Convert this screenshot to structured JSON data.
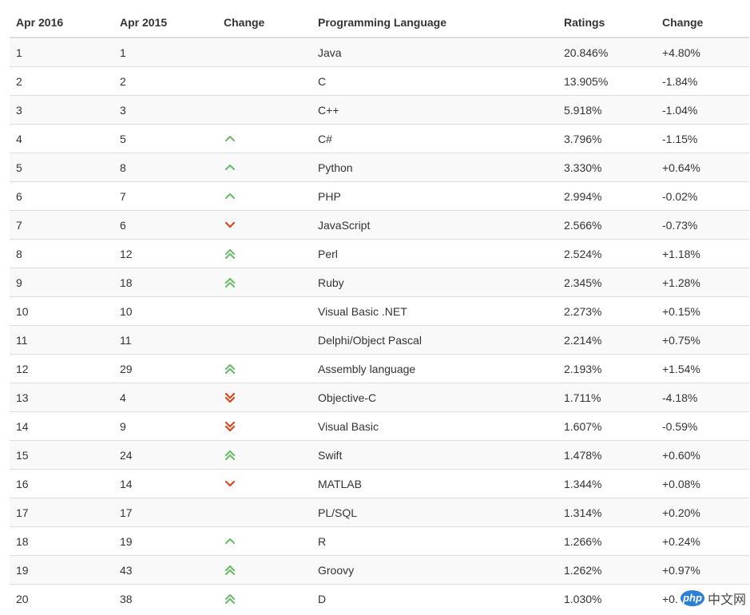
{
  "table": {
    "headers": [
      "Apr 2016",
      "Apr 2015",
      "Change",
      "Programming Language",
      "Ratings",
      "Change"
    ],
    "rows": [
      {
        "rank_2016": "1",
        "rank_2015": "1",
        "trend": "none",
        "language": "Java",
        "rating": "20.846%",
        "change": "+4.80%"
      },
      {
        "rank_2016": "2",
        "rank_2015": "2",
        "trend": "none",
        "language": "C",
        "rating": "13.905%",
        "change": "-1.84%"
      },
      {
        "rank_2016": "3",
        "rank_2015": "3",
        "trend": "none",
        "language": "C++",
        "rating": "5.918%",
        "change": "-1.04%"
      },
      {
        "rank_2016": "4",
        "rank_2015": "5",
        "trend": "up",
        "language": "C#",
        "rating": "3.796%",
        "change": "-1.15%"
      },
      {
        "rank_2016": "5",
        "rank_2015": "8",
        "trend": "up",
        "language": "Python",
        "rating": "3.330%",
        "change": "+0.64%"
      },
      {
        "rank_2016": "6",
        "rank_2015": "7",
        "trend": "up",
        "language": "PHP",
        "rating": "2.994%",
        "change": "-0.02%"
      },
      {
        "rank_2016": "7",
        "rank_2015": "6",
        "trend": "down",
        "language": "JavaScript",
        "rating": "2.566%",
        "change": "-0.73%"
      },
      {
        "rank_2016": "8",
        "rank_2015": "12",
        "trend": "double-up",
        "language": "Perl",
        "rating": "2.524%",
        "change": "+1.18%"
      },
      {
        "rank_2016": "9",
        "rank_2015": "18",
        "trend": "double-up",
        "language": "Ruby",
        "rating": "2.345%",
        "change": "+1.28%"
      },
      {
        "rank_2016": "10",
        "rank_2015": "10",
        "trend": "none",
        "language": "Visual Basic .NET",
        "rating": "2.273%",
        "change": "+0.15%"
      },
      {
        "rank_2016": "11",
        "rank_2015": "11",
        "trend": "none",
        "language": "Delphi/Object Pascal",
        "rating": "2.214%",
        "change": "+0.75%"
      },
      {
        "rank_2016": "12",
        "rank_2015": "29",
        "trend": "double-up",
        "language": "Assembly language",
        "rating": "2.193%",
        "change": "+1.54%"
      },
      {
        "rank_2016": "13",
        "rank_2015": "4",
        "trend": "double-down",
        "language": "Objective-C",
        "rating": "1.711%",
        "change": "-4.18%"
      },
      {
        "rank_2016": "14",
        "rank_2015": "9",
        "trend": "double-down",
        "language": "Visual Basic",
        "rating": "1.607%",
        "change": "-0.59%"
      },
      {
        "rank_2016": "15",
        "rank_2015": "24",
        "trend": "double-up",
        "language": "Swift",
        "rating": "1.478%",
        "change": "+0.60%"
      },
      {
        "rank_2016": "16",
        "rank_2015": "14",
        "trend": "down",
        "language": "MATLAB",
        "rating": "1.344%",
        "change": "+0.08%"
      },
      {
        "rank_2016": "17",
        "rank_2015": "17",
        "trend": "none",
        "language": "PL/SQL",
        "rating": "1.314%",
        "change": "+0.20%"
      },
      {
        "rank_2016": "18",
        "rank_2015": "19",
        "trend": "up",
        "language": "R",
        "rating": "1.266%",
        "change": "+0.24%"
      },
      {
        "rank_2016": "19",
        "rank_2015": "43",
        "trend": "double-up",
        "language": "Groovy",
        "rating": "1.262%",
        "change": "+0.97%"
      },
      {
        "rank_2016": "20",
        "rank_2015": "38",
        "trend": "double-up",
        "language": "D",
        "rating": "1.030%",
        "change": "+0."
      }
    ]
  },
  "icons": {
    "up": "chevron-up-icon",
    "double-up": "double-chevron-up-icon",
    "down": "chevron-down-icon",
    "double-down": "double-chevron-down-icon"
  },
  "colors": {
    "up": "#6bbf6b",
    "down": "#e1461d",
    "stripe": "#f9f9f9",
    "border": "#dddddd"
  },
  "watermark": {
    "badge": "php",
    "text": "中文网"
  }
}
